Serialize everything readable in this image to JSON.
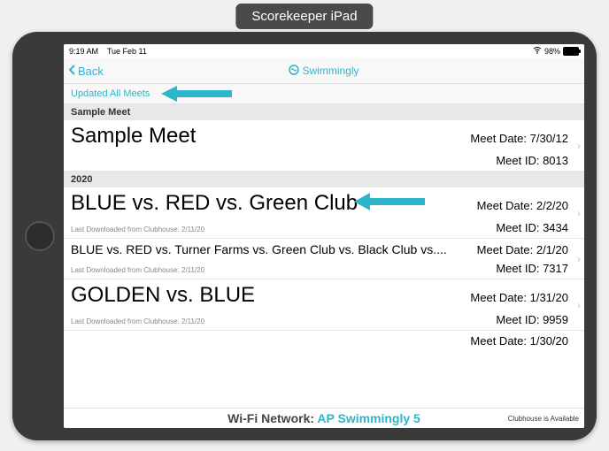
{
  "chip": "Scorekeeper iPad",
  "status": {
    "time": "9:19 AM",
    "date": "Tue Feb 11",
    "battery_pct": "98%"
  },
  "nav": {
    "back": "Back",
    "title": "Swimmingly"
  },
  "subnav": {
    "update": "Updated All Meets"
  },
  "sections": [
    {
      "header": "Sample Meet",
      "rows": [
        {
          "title": "Sample Meet",
          "date_label": "Meet Date: 7/30/12",
          "id_label": "Meet ID: 8013",
          "size": "lg",
          "note": ""
        }
      ]
    },
    {
      "header": "2020",
      "rows": [
        {
          "title": "BLUE vs. RED vs. Green Club",
          "date_label": "Meet Date: 2/2/20",
          "id_label": "Meet ID: 3434",
          "size": "lg",
          "note": "Last Downloaded from Clubhouse: 2/11/20"
        },
        {
          "title": "BLUE vs. RED vs. Turner Farms vs. Green Club vs. Black Club vs....",
          "date_label": "Meet Date: 2/1/20",
          "id_label": "Meet ID: 7317",
          "size": "sm",
          "note": "Last Downloaded from Clubhouse: 2/11/20"
        },
        {
          "title": "GOLDEN vs. BLUE",
          "date_label": "Meet Date: 1/31/20",
          "id_label": "Meet ID: 9959",
          "size": "lg",
          "note": "Last Downloaded from Clubhouse: 2/11/20"
        },
        {
          "title": "",
          "date_label": "Meet Date: 1/30/20",
          "id_label": "",
          "size": "sm",
          "note": ""
        }
      ]
    }
  ],
  "footer": {
    "wifi_prefix": "Wi-Fi Network: ",
    "wifi_name": "AP Swimmingly 5",
    "clubhouse": "Clubhouse is Available"
  },
  "colors": {
    "accent": "#2db5cc"
  }
}
